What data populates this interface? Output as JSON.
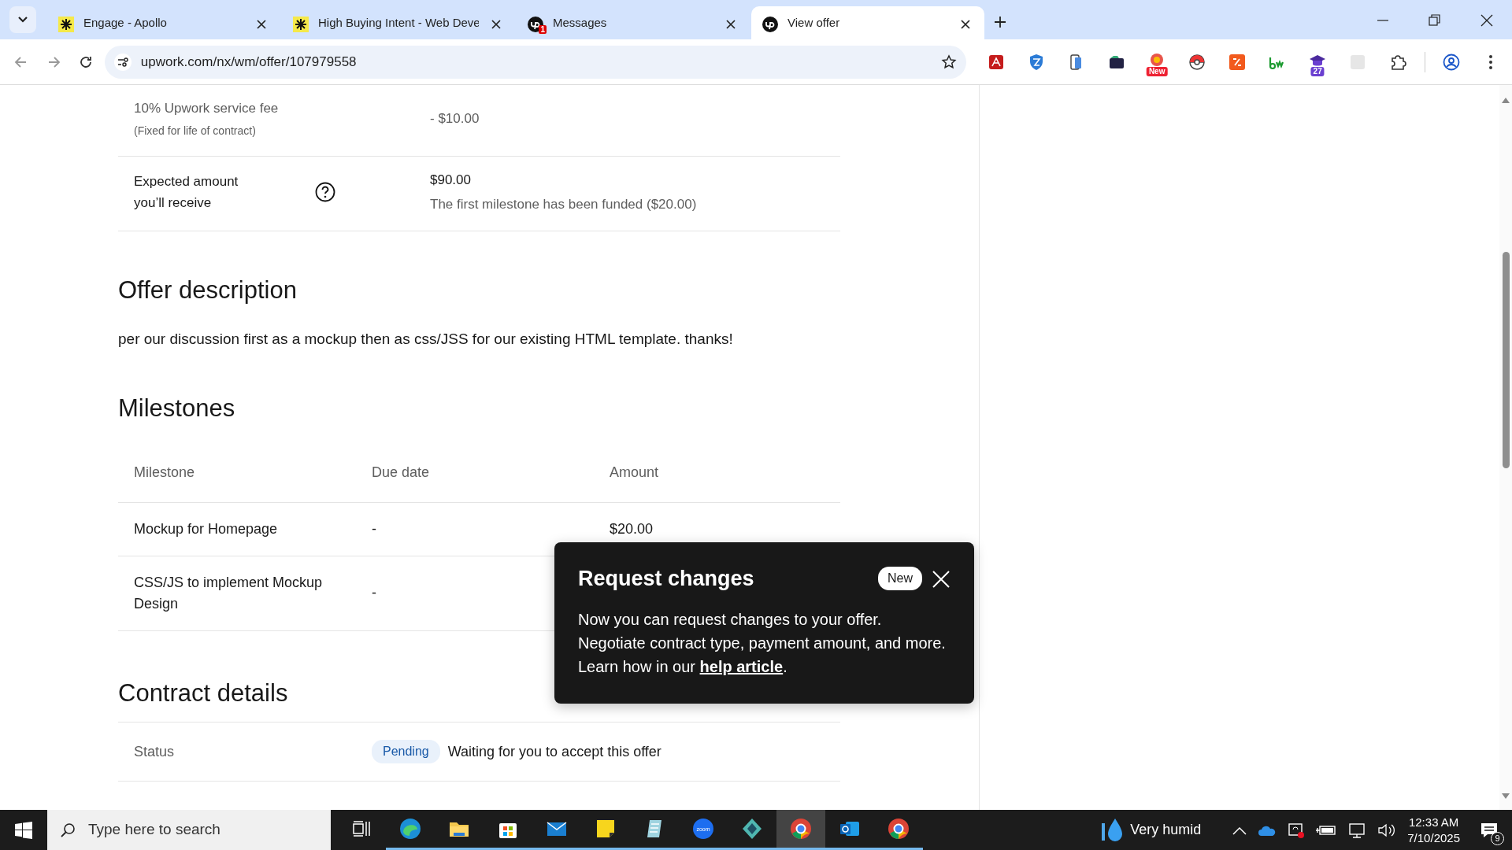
{
  "tabs": [
    {
      "title": "Engage - Apollo",
      "kind": "apollo",
      "selected": false
    },
    {
      "title": "High Buying Intent - Web Deve",
      "kind": "apollo",
      "selected": false
    },
    {
      "title": "Messages",
      "kind": "upwork",
      "badge": "1",
      "selected": false
    },
    {
      "title": "View offer",
      "kind": "upwork",
      "selected": true
    }
  ],
  "address_bar": {
    "url": "upwork.com/nx/wm/offer/107979558"
  },
  "extension_badges": [
    "New",
    "27"
  ],
  "summary_rows": [
    {
      "label": "10% Upwork service fee",
      "sublabel": "(Fixed for life of contract)",
      "value": "- $10.00"
    },
    {
      "label": "Expected amount you’ll receive",
      "help": true,
      "value": "$90.00",
      "note": "The first milestone has been funded ($20.00)"
    }
  ],
  "offer_description": {
    "heading": "Offer description",
    "text": "per our discussion first as a mockup then as css/JSS for our existing HTML template. thanks!"
  },
  "milestones": {
    "heading": "Milestones",
    "columns": [
      "Milestone",
      "Due date",
      "Amount"
    ],
    "rows": [
      [
        "Mockup for Homepage",
        "-",
        "$20.00"
      ],
      [
        "CSS/JS to implement Mockup Design",
        "-"
      ]
    ]
  },
  "contract_details": {
    "heading": "Contract details",
    "rows": [
      {
        "label": "Status",
        "badge": "Pending",
        "value": "Waiting for you to accept this offer"
      }
    ]
  },
  "popover": {
    "title": "Request changes",
    "badge": "New",
    "text_before": "Now you can request changes to your offer. Negotiate contract type, payment amount, and more. Learn how in our",
    "link": "help article",
    "text_after": "."
  },
  "taskbar": {
    "search_placeholder": "Type here to search",
    "apps": [
      {
        "kind": "edge",
        "selected": false
      },
      {
        "kind": "folder",
        "selected": false
      },
      {
        "kind": "store",
        "selected": false
      },
      {
        "kind": "mail",
        "selected": false
      },
      {
        "kind": "note",
        "selected": false
      },
      {
        "kind": "notepad",
        "selected": false
      },
      {
        "kind": "zoom",
        "selected": false
      },
      {
        "kind": "gem",
        "selected": false
      },
      {
        "kind": "chrome",
        "selected": true
      },
      {
        "kind": "outlook",
        "selected": false
      },
      {
        "kind": "chrome",
        "selected": false
      }
    ],
    "weather": "Very humid",
    "time": "12:33 AM",
    "date": "7/10/2025",
    "notifications": "9"
  }
}
